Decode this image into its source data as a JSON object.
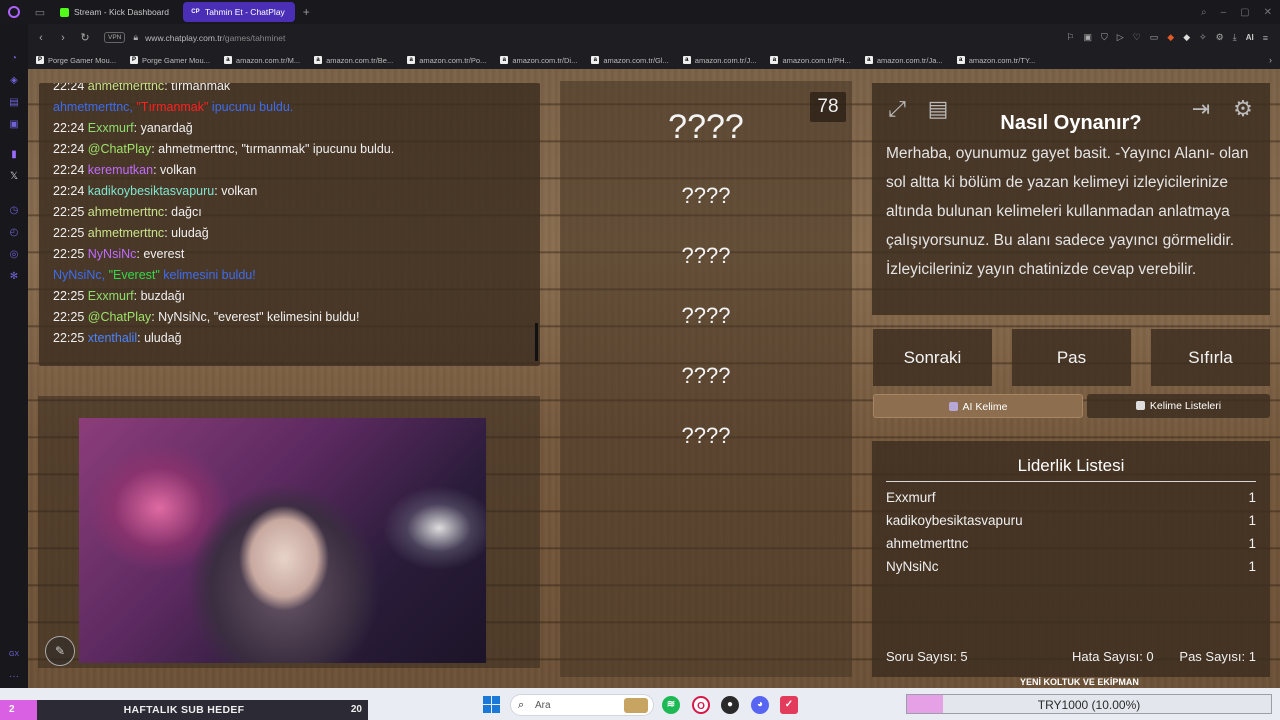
{
  "browser": {
    "tabs": [
      {
        "label": "Stream - Kick Dashboard",
        "active": false
      },
      {
        "label": "Tahmin Et - ChatPlay",
        "active": true
      }
    ],
    "address": {
      "vpn": "VPN",
      "host": "www.chatplay.com.tr",
      "path": "/games/tahminet"
    },
    "ai_label": "AI",
    "bookmarks": [
      "Porge Gamer Mou...",
      "Porge Gamer Mou...",
      "amazon.com.tr/M...",
      "amazon.com.tr/Be...",
      "amazon.com.tr/Po...",
      "amazon.com.tr/Di...",
      "amazon.com.tr/Gl...",
      "amazon.com.tr/J...",
      "amazon.com.tr/PH...",
      "amazon.com.tr/Ja...",
      "amazon.com.tr/TY..."
    ]
  },
  "chat": {
    "lines": [
      {
        "time": "22:24",
        "user": "ahmetmerttnc",
        "sep": ": ",
        "msg": "tırmanmak"
      },
      {
        "system_user": "ahmetmerttnc",
        "system_mid": ", ",
        "system_word": "\"Tırmanmak\"",
        "system_tail": " ipucunu buldu."
      },
      {
        "time": "22:24",
        "user": "Exxmurf",
        "sep": ": ",
        "msg": "yanardağ"
      },
      {
        "time": "22:24",
        "user": "@ChatPlay",
        "sep": ": ",
        "msg": "ahmetmerttnc, \"tırmanmak\" ipucunu buldu."
      },
      {
        "time": "22:24",
        "user": "keremutkan",
        "sep": ": ",
        "msg": "volkan"
      },
      {
        "time": "22:24",
        "user": "kadikoybesiktasvapuru",
        "sep": ": ",
        "msg": "volkan"
      },
      {
        "time": "22:25",
        "user": "ahmetmerttnc",
        "sep": ": ",
        "msg": "dağcı"
      },
      {
        "time": "22:25",
        "user": "ahmetmerttnc",
        "sep": ": ",
        "msg": "uludağ"
      },
      {
        "time": "22:25",
        "user": "NyNsiNc",
        "sep": ": ",
        "msg": "everest"
      },
      {
        "system_user": "NyNsiNc",
        "system_mid": ", ",
        "system_word": "\"Everest\"",
        "system_tail": " kelimesini buldu!"
      },
      {
        "time": "22:25",
        "user": "Exxmurf",
        "sep": ": ",
        "msg": "buzdağı"
      },
      {
        "time": "22:25",
        "user": "@ChatPlay",
        "sep": ": ",
        "msg": "NyNsiNc, \"everest\" kelimesini buldu!"
      },
      {
        "time": "22:25",
        "user": "xtenthalil",
        "sep": ": ",
        "msg": "uludağ"
      }
    ]
  },
  "game": {
    "timer": "78",
    "main_word": "????",
    "hint_words": [
      "????",
      "????",
      "????",
      "????",
      "????"
    ]
  },
  "info": {
    "title": "Nasıl Oynanır?",
    "text": "Merhaba, oyunumuz gayet basit. -Yayıncı Alanı- olan sol altta ki bölüm de yazan kelimeyi izleyicilerinize altında bulunan kelimeleri kullanmadan anlatmaya çalışıyorsunuz. Bu alanı sadece yayıncı görmelidir. İzleyicileriniz yayın chatinizde cevap verebilir."
  },
  "actions": {
    "next": "Sonraki",
    "pass": "Pas",
    "reset": "Sıfırla"
  },
  "modes": {
    "ai": "AI Kelime",
    "lists": "Kelime Listeleri"
  },
  "leaderboard": {
    "title": "Liderlik Listesi",
    "rows": [
      {
        "name": "Exxmurf",
        "score": "1"
      },
      {
        "name": "kadikoybesiktasvapuru",
        "score": "1"
      },
      {
        "name": "ahmetmerttnc",
        "score": "1"
      },
      {
        "name": "NyNsiNc",
        "score": "1"
      }
    ]
  },
  "stats": {
    "questions": "Soru Sayısı: 5",
    "errors": "Hata Sayısı: 0",
    "passes": "Pas Sayısı: 1"
  },
  "overlays": {
    "sub_goal_count": "2",
    "sub_goal_label": "HAFTALIK SUB HEDEF",
    "sub_goal_target": "20",
    "sub_goal_progress": 0.1,
    "koltuk_label": "YENİ KOLTUK VE EKİPMAN",
    "donation_label": "TRY1000 (10.00%)",
    "donation_progress": 0.1
  },
  "taskbar": {
    "search_placeholder": "Ara"
  },
  "colors": {
    "accent_tab": "#4a2fb6",
    "wood": "#7b6247",
    "sub_fill": "#d95fe3",
    "donation_fill": "#e6a0e6"
  }
}
